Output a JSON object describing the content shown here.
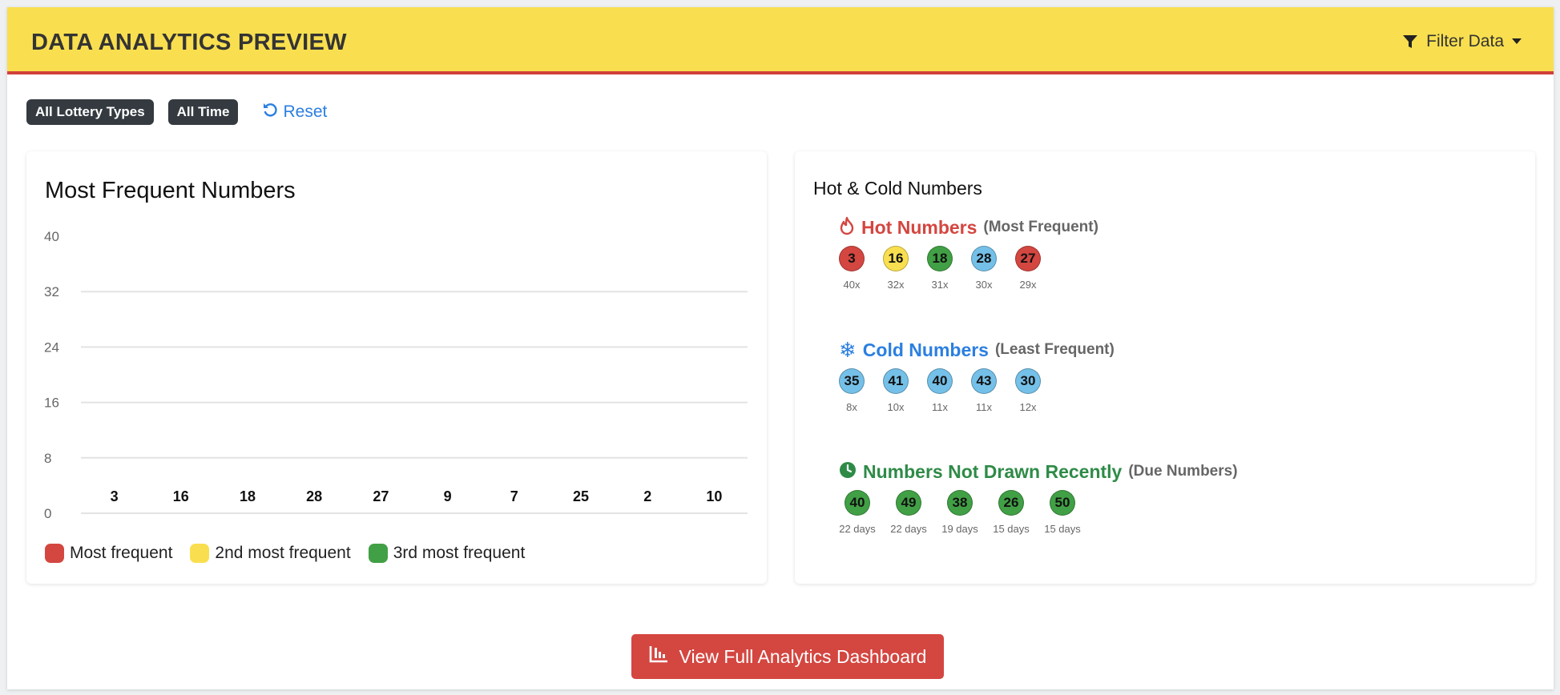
{
  "header": {
    "title": "DATA ANALYTICS PREVIEW",
    "filter_label": "Filter Data"
  },
  "filters": {
    "chips": [
      "All Lottery Types",
      "All Time"
    ],
    "reset_label": "Reset"
  },
  "frequency_panel": {
    "title": "Most Frequent Numbers",
    "legend": [
      {
        "label": "Most frequent",
        "color": "#d44640"
      },
      {
        "label": "2nd most frequent",
        "color": "#f9df4f"
      },
      {
        "label": "3rd most frequent",
        "color": "#41a045"
      }
    ]
  },
  "chart_data": {
    "type": "bar",
    "categories": [
      "3",
      "16",
      "18",
      "28",
      "27",
      "9",
      "7",
      "25",
      "2",
      "10"
    ],
    "ylim": [
      0,
      40
    ],
    "yticks": [
      0,
      8,
      16,
      24,
      32,
      40
    ],
    "grid": true,
    "legend_position": "bottom-left",
    "title": "Most Frequent Numbers"
  },
  "hot_cold": {
    "title": "Hot & Cold Numbers",
    "hot": {
      "name": "Hot Numbers",
      "sub": "(Most Frequent)",
      "color": "#d44640",
      "icon": "fire-icon",
      "items": [
        {
          "number": "3",
          "label": "40x",
          "color": "#d44640"
        },
        {
          "number": "16",
          "label": "32x",
          "color": "#f9df4f"
        },
        {
          "number": "18",
          "label": "31x",
          "color": "#41a045"
        },
        {
          "number": "28",
          "label": "30x",
          "color": "#74c0e8"
        },
        {
          "number": "27",
          "label": "29x",
          "color": "#d44640"
        }
      ]
    },
    "cold": {
      "name": "Cold Numbers",
      "sub": "(Least Frequent)",
      "color": "#2b7fe0",
      "icon": "snowflake-icon",
      "items": [
        {
          "number": "35",
          "label": "8x",
          "color": "#74c0e8"
        },
        {
          "number": "41",
          "label": "10x",
          "color": "#74c0e8"
        },
        {
          "number": "40",
          "label": "11x",
          "color": "#74c0e8"
        },
        {
          "number": "43",
          "label": "11x",
          "color": "#74c0e8"
        },
        {
          "number": "30",
          "label": "12x",
          "color": "#74c0e8"
        }
      ]
    },
    "due": {
      "name": "Numbers Not Drawn Recently",
      "sub": "(Due Numbers)",
      "color": "#2e8b47",
      "icon": "clock-icon",
      "items": [
        {
          "number": "40",
          "label": "22 days",
          "color": "#41a045"
        },
        {
          "number": "49",
          "label": "22 days",
          "color": "#41a045"
        },
        {
          "number": "38",
          "label": "19 days",
          "color": "#41a045"
        },
        {
          "number": "26",
          "label": "15 days",
          "color": "#41a045"
        },
        {
          "number": "50",
          "label": "15 days",
          "color": "#41a045"
        }
      ]
    }
  },
  "cta": {
    "label": "View Full Analytics Dashboard",
    "icon": "bar-chart-icon"
  }
}
